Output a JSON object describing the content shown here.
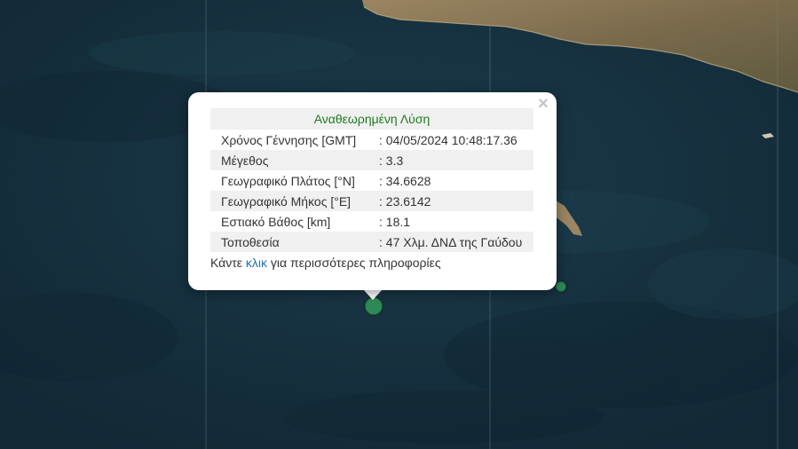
{
  "popup": {
    "title": "Αναθεωρημένη Λύση",
    "close_symbol": "×",
    "rows": [
      {
        "label": "Χρόνος Γέννησης [GMT]",
        "value": ": 04/05/2024 10:48:17.36"
      },
      {
        "label": "Μέγεθος",
        "value": ": 3.3"
      },
      {
        "label": "Γεωγραφικό Πλάτος [°N]",
        "value": ": 34.6628"
      },
      {
        "label": "Γεωγραφικό Μήκος [°E]",
        "value": ": 23.6142"
      },
      {
        "label": "Εστιακό Βάθος [km]",
        "value": ": 18.1"
      },
      {
        "label": "Τοποθεσία",
        "value": ": 47 Χλμ. ΔΝΔ της Γαύδου"
      }
    ],
    "more": {
      "prefix": "Κάντε ",
      "link": "κλικ",
      "suffix": " για περισσότερες πληροφορίες"
    }
  },
  "colors": {
    "sea": "#16303f",
    "land": "#8a7456",
    "marker": "#2e8b57",
    "title_green": "#1f7a1f",
    "link": "#1a75b8"
  }
}
